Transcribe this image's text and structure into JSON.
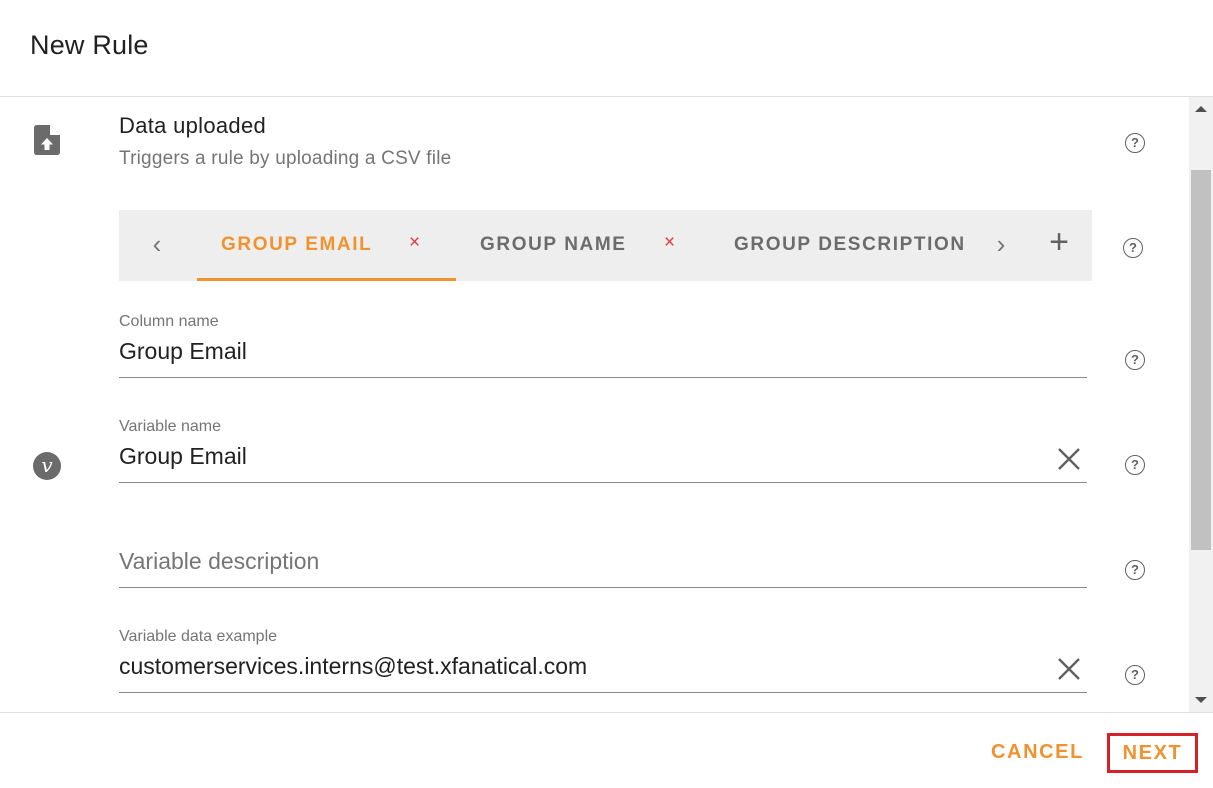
{
  "dialog": {
    "title": "New Rule"
  },
  "trigger": {
    "icon": "file-upload-icon",
    "title": "Data uploaded",
    "subtitle": "Triggers a rule by uploading a CSV file"
  },
  "tabs": {
    "prev_icon": "‹",
    "next_icon": "›",
    "add_icon": "+",
    "close_icon": "×",
    "items": [
      {
        "label": "GROUP EMAIL",
        "active": true
      },
      {
        "label": "GROUP NAME",
        "active": false
      },
      {
        "label": "GROUP DESCRIPTION",
        "active": false
      }
    ]
  },
  "form": {
    "column_name": {
      "label": "Column name",
      "value": "Group Email"
    },
    "variable_name": {
      "label": "Variable name",
      "value": "Group Email"
    },
    "variable_description": {
      "label": "",
      "value": "",
      "placeholder": "Variable description"
    },
    "variable_data_example": {
      "label": "Variable data example",
      "value": "customerservices.interns@test.xfanatical.com"
    }
  },
  "variable_icon": "v",
  "help_icon": "?",
  "footer": {
    "cancel_label": "CANCEL",
    "next_label": "NEXT"
  },
  "colors": {
    "accent": "#f0922e",
    "close_red": "#e53935",
    "highlight_border": "#d3222a"
  }
}
